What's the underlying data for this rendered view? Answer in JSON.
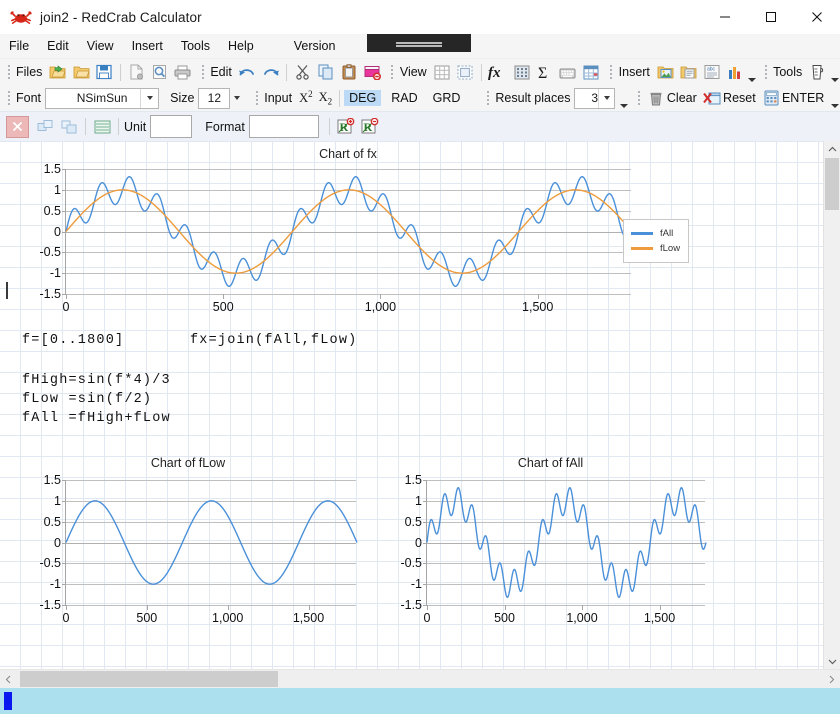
{
  "window": {
    "title": "join2 - RedCrab Calculator",
    "app_icon": "crab-icon",
    "minimize": "—",
    "maximize": "□",
    "close": "✕"
  },
  "menubar": {
    "items": [
      "File",
      "Edit",
      "View",
      "Insert",
      "Tools",
      "Help",
      "Version"
    ]
  },
  "toolbar_main": {
    "groups": [
      {
        "label": "Files",
        "icons": [
          "open-folder-green-icon",
          "folder-yellow-icon",
          "save-disk-icon",
          "new-document-icon",
          "print-preview-icon",
          "print-icon"
        ]
      },
      {
        "label": "Edit",
        "icons": [
          "undo-icon",
          "redo-icon",
          "cut-scissors-icon",
          "copy-icon",
          "paste-icon",
          "delete-block-icon"
        ]
      },
      {
        "label": "View",
        "icons": [
          "grid-icon",
          "frame-icon",
          "fx-function-icon",
          "matrix-icon",
          "sigma-sum-icon",
          "keyboard-icon",
          "table-icon"
        ]
      },
      {
        "label": "Insert",
        "icons": [
          "insert-image-icon",
          "insert-note-icon",
          "insert-text-icon",
          "insert-chart-icon"
        ]
      },
      {
        "label": "Tools",
        "icons": [
          "measuring-cup-icon"
        ]
      }
    ]
  },
  "toolbar_format": {
    "font_label": "Font",
    "font_value": "NSimSun",
    "size_label": "Size",
    "size_value": "12",
    "input_label": "Input",
    "superscript": "X²",
    "subscript": "X₂",
    "angle_modes": [
      "DEG",
      "RAD",
      "GRD"
    ],
    "angle_selected": "DEG",
    "result_places_label": "Result places",
    "result_places_value": "3",
    "clear_label": "Clear",
    "reset_label": "Reset",
    "enter_label": "ENTER",
    "clear_icon": "trash-icon",
    "reset_icon": "red-x-window-icon",
    "enter_icon": "calculator-icon"
  },
  "toolbar_unit": {
    "close_icon": "red-x-icon",
    "group_icon": "group-objects-icon",
    "ungroup_icon": "ungroup-objects-icon",
    "lines_icon": "lines-icon",
    "unit_label": "Unit",
    "unit_value": "",
    "format_label": "Format",
    "format_value": "",
    "add_region_icon": "add-region-icon",
    "remove_region_icon": "remove-region-icon"
  },
  "document": {
    "formulas": [
      {
        "text": "f=[0..1800]"
      },
      {
        "text": "fx=join(fAll,fLow)"
      },
      {
        "text": "fHigh=sin(f*4)/3"
      },
      {
        "text": "fLow =sin(f/2)"
      },
      {
        "text": "fAll =fHigh+fLow"
      }
    ]
  },
  "chart_data": [
    {
      "id": "chart-fx",
      "type": "line",
      "title": "Chart of fx",
      "xlabel": "",
      "ylabel": "",
      "xlim": [
        0,
        1800
      ],
      "ylim": [
        -1.5,
        1.5
      ],
      "xticks": [
        0,
        500,
        1000,
        1500
      ],
      "xticklabels": [
        "0",
        "500",
        "1,000",
        "1,500"
      ],
      "yticks": [
        -1.5,
        -1,
        -0.5,
        0,
        0.5,
        1,
        1.5
      ],
      "yticklabels": [
        "-1.5",
        "-1",
        "-0.5",
        "0",
        "0.5",
        "1",
        "1.5"
      ],
      "grid": true,
      "legend": "right",
      "series": [
        {
          "name": "fAll",
          "color": "#4a90d9",
          "formula": "sin(f*4)/3 + sin(f/2)"
        },
        {
          "name": "fLow",
          "color": "#ed9b3c",
          "formula": "sin(f/2)"
        }
      ]
    },
    {
      "id": "chart-flow",
      "type": "line",
      "title": "Chart of fLow",
      "xlim": [
        0,
        1800
      ],
      "ylim": [
        -1.5,
        1.5
      ],
      "xticks": [
        0,
        500,
        1000,
        1500
      ],
      "xticklabels": [
        "0",
        "500",
        "1,000",
        "1,500"
      ],
      "yticks": [
        -1.5,
        -1,
        -0.5,
        0,
        0.5,
        1,
        1.5
      ],
      "yticklabels": [
        "-1.5",
        "-1",
        "-0.5",
        "0",
        "0.5",
        "1",
        "1.5"
      ],
      "grid": true,
      "legend": "none",
      "series": [
        {
          "name": "fLow",
          "color": "#4a90d9",
          "formula": "sin(f/2)"
        }
      ]
    },
    {
      "id": "chart-fall",
      "type": "line",
      "title": "Chart of fAll",
      "xlim": [
        0,
        1800
      ],
      "ylim": [
        -1.5,
        1.5
      ],
      "xticks": [
        0,
        500,
        1000,
        1500
      ],
      "xticklabels": [
        "0",
        "500",
        "1,000",
        "1,500"
      ],
      "yticks": [
        -1.5,
        -1,
        -0.5,
        0,
        0.5,
        1,
        1.5
      ],
      "yticklabels": [
        "-1.5",
        "-1",
        "-0.5",
        "0",
        "0.5",
        "1",
        "1.5"
      ],
      "grid": true,
      "legend": "none",
      "series": [
        {
          "name": "fAll",
          "color": "#4a90d9",
          "formula": "sin(f*4)/3 + sin(f/2)"
        }
      ]
    }
  ],
  "colors": {
    "series_blue": "#4a90d9",
    "series_orange": "#ed9b3c",
    "angle_active": "#bcd9f5",
    "status_bar": "#ade0ef",
    "status_mark": "#0a18f0"
  }
}
